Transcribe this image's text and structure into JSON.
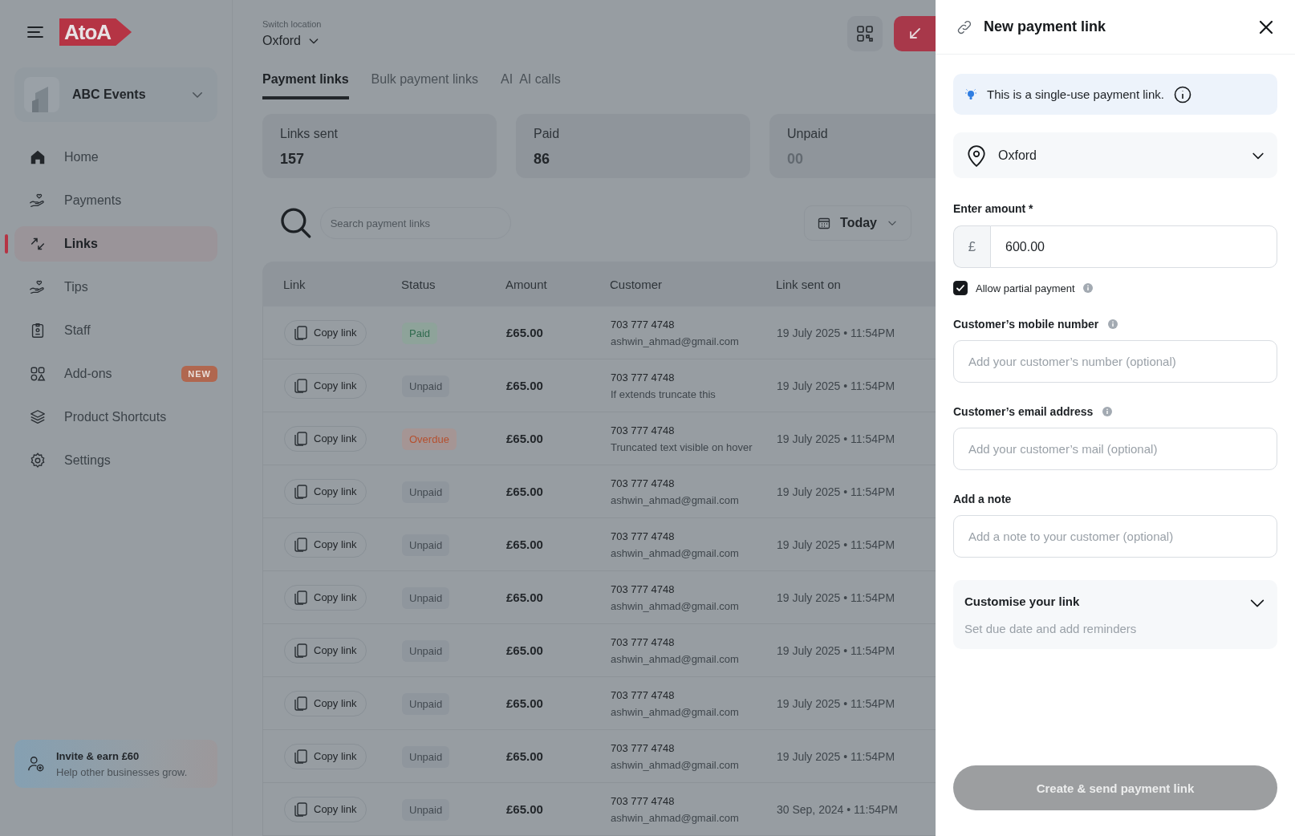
{
  "sidebar": {
    "logo": "AtoA",
    "business": {
      "name": "ABC Events"
    },
    "items": [
      {
        "label": "Home",
        "selected": false
      },
      {
        "label": "Payments",
        "selected": false
      },
      {
        "label": "Links",
        "selected": true
      },
      {
        "label": "Tips",
        "selected": false
      },
      {
        "label": "Staff",
        "selected": false
      },
      {
        "label": "Add-ons",
        "selected": false,
        "badge": "NEW"
      },
      {
        "label": "Product Shortcuts",
        "selected": false
      },
      {
        "label": "Settings",
        "selected": false
      }
    ],
    "invite": {
      "title": "Invite & earn £60",
      "subtitle": "Help other businesses grow."
    }
  },
  "header": {
    "location_label": "Switch location",
    "location": "Oxford"
  },
  "tabs": [
    {
      "label": "Payment links",
      "selected": true
    },
    {
      "label": "Bulk payment links",
      "selected": false
    },
    {
      "prefix": "AI",
      "label": "AI calls",
      "selected": false
    }
  ],
  "stats": [
    {
      "label": "Links sent",
      "value": "157",
      "muted": false
    },
    {
      "label": "Paid",
      "value": "86",
      "muted": false
    },
    {
      "label": "Unpaid",
      "value": "00",
      "muted": true
    }
  ],
  "search": {
    "placeholder": "Search payment links"
  },
  "date_filter": {
    "label": "Today"
  },
  "table": {
    "columns": [
      "Link",
      "Status",
      "Amount",
      "Customer",
      "Link sent on"
    ],
    "rows": [
      {
        "link": "Copy link",
        "status": "Paid",
        "kind": "paid",
        "amount": "£65.00",
        "phone": "703 777 4748",
        "detail": "ashwin_ahmad@gmail.com",
        "sent_on": "19 July 2025 • 11:54PM"
      },
      {
        "link": "Copy link",
        "status": "Unpaid",
        "kind": "unpaid",
        "amount": "£65.00",
        "phone": "703 777 4748",
        "detail": "If extends truncate this",
        "sent_on": "19 July 2025 • 11:54PM"
      },
      {
        "link": "Copy link",
        "status": "Overdue",
        "kind": "overdue",
        "amount": "£65.00",
        "phone": "703 777 4748",
        "detail": "Truncated text visible on hover",
        "sent_on": "19 July 2025 • 11:54PM"
      },
      {
        "link": "Copy link",
        "status": "Unpaid",
        "kind": "unpaid",
        "amount": "£65.00",
        "phone": "703 777 4748",
        "detail": "ashwin_ahmad@gmail.com",
        "sent_on": "19 July 2025 • 11:54PM"
      },
      {
        "link": "Copy link",
        "status": "Unpaid",
        "kind": "unpaid",
        "amount": "£65.00",
        "phone": "703 777 4748",
        "detail": "ashwin_ahmad@gmail.com",
        "sent_on": "19 July 2025 • 11:54PM"
      },
      {
        "link": "Copy link",
        "status": "Unpaid",
        "kind": "unpaid",
        "amount": "£65.00",
        "phone": "703 777 4748",
        "detail": "ashwin_ahmad@gmail.com",
        "sent_on": "19 July 2025 • 11:54PM"
      },
      {
        "link": "Copy link",
        "status": "Unpaid",
        "kind": "unpaid",
        "amount": "£65.00",
        "phone": "703 777 4748",
        "detail": "ashwin_ahmad@gmail.com",
        "sent_on": "19 July 2025 • 11:54PM"
      },
      {
        "link": "Copy link",
        "status": "Unpaid",
        "kind": "unpaid",
        "amount": "£65.00",
        "phone": "703 777 4748",
        "detail": "ashwin_ahmad@gmail.com",
        "sent_on": "19 July 2025 • 11:54PM"
      },
      {
        "link": "Copy link",
        "status": "Unpaid",
        "kind": "unpaid",
        "amount": "£65.00",
        "phone": "703 777 4748",
        "detail": "ashwin_ahmad@gmail.com",
        "sent_on": "19 July 2025 • 11:54PM"
      },
      {
        "link": "Copy link",
        "status": "Unpaid",
        "kind": "unpaid",
        "amount": "£65.00",
        "phone": "703 777 4748",
        "detail": "ashwin_ahmad@gmail.com",
        "sent_on": "30 Sep, 2024 • 11:54PM"
      }
    ]
  },
  "panel": {
    "title": "New payment link",
    "notice": "This is a single-use payment link.",
    "location": "Oxford",
    "amount": {
      "label": "Enter amount *",
      "currency": "£",
      "value": "600.00"
    },
    "partial_payment": {
      "label": "Allow partial payment",
      "checked": true
    },
    "mobile": {
      "label": "Customer’s mobile number",
      "placeholder": "Add your customer’s number (optional)"
    },
    "email": {
      "label": "Customer’s email address",
      "placeholder": "Add your customer’s mail (optional)"
    },
    "note": {
      "label": "Add a note",
      "placeholder": "Add a note to your customer (optional)"
    },
    "customise": {
      "title": "Customise your link",
      "subtitle": "Set due date and add reminders",
      "expanded": false
    },
    "submit": {
      "label": "Create & send payment link",
      "disabled": true
    }
  }
}
